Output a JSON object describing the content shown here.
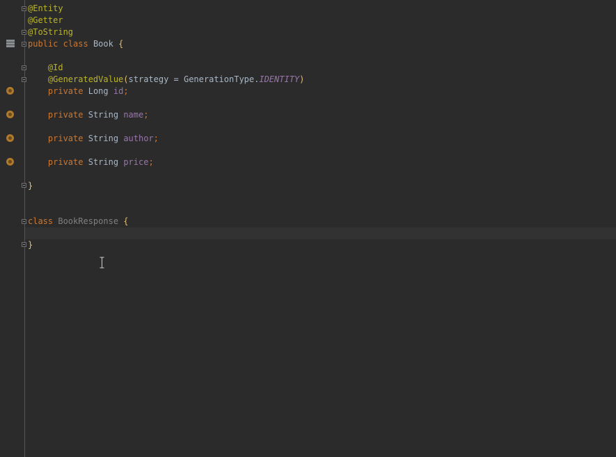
{
  "editor": {
    "language": "java",
    "lines": {
      "l1": {
        "ann": "@Entity"
      },
      "l2": {
        "ann": "@Getter"
      },
      "l3": {
        "ann": "@ToString"
      },
      "l4": {
        "kw1": "public",
        "kw2": "class",
        "cls": "Book",
        "brace": "{"
      },
      "l6": {
        "ann": "@Id"
      },
      "l7": {
        "ann": "@GeneratedValue",
        "open": "(",
        "param": "strategy = GenerationType.",
        "const": "IDENTITY",
        "close": ")"
      },
      "l8": {
        "kw": "private",
        "type": "Long",
        "field": "id",
        "semi": ";"
      },
      "l10": {
        "kw": "private",
        "type": "String",
        "field": "name",
        "semi": ";"
      },
      "l12": {
        "kw": "private",
        "type": "String",
        "field": "author",
        "semi": ";"
      },
      "l14": {
        "kw": "private",
        "type": "String",
        "field": "price",
        "semi": ";"
      },
      "l16": {
        "brace": "}"
      },
      "l19": {
        "kw": "class",
        "cls": "BookResponse",
        "brace": "{"
      },
      "l21": {
        "brace": "}"
      }
    }
  },
  "colors": {
    "background": "#2b2b2b",
    "keyword": "#cc7832",
    "annotation": "#bbb529",
    "field": "#9876aa",
    "text": "#a9b7c6",
    "unused_class": "#808080",
    "current_line": "#323232"
  },
  "gutter_icons": [
    "database-icon",
    "field-icon",
    "field-icon",
    "field-icon",
    "field-icon"
  ]
}
